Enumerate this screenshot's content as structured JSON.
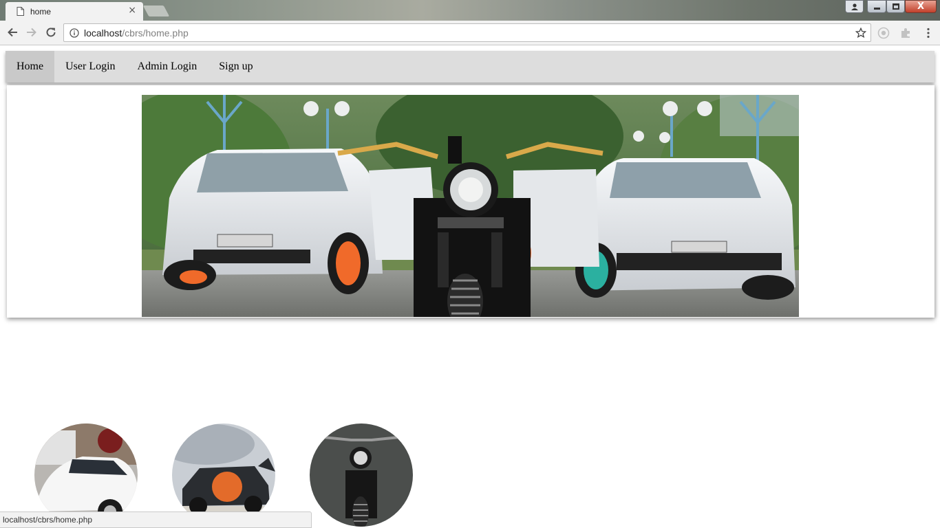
{
  "browser": {
    "tab": {
      "title": "home",
      "close_glyph": "×",
      "icon": "document-icon"
    },
    "window_controls": {
      "close_glyph": "X"
    },
    "url": {
      "host": "localhost",
      "path": "/cbrs/home.php"
    }
  },
  "nav": {
    "items": [
      {
        "label": "Home",
        "active": true
      },
      {
        "label": "User Login",
        "active": false
      },
      {
        "label": "Admin Login",
        "active": false
      },
      {
        "label": "Sign up",
        "active": false
      }
    ]
  },
  "banner": {
    "subject": "banner-image",
    "brand_colors": {
      "asphalt": "#8a8c88",
      "foliage": "#3f6b2f",
      "car_white": "#eef1f3",
      "rim_orange": "#f06a2a",
      "rim_teal": "#2bb0a0"
    }
  },
  "thumbnails": [
    {
      "subject": "white-sedan-icon"
    },
    {
      "subject": "suv-icon"
    },
    {
      "subject": "motorcycle-icon"
    }
  ],
  "status_bar": {
    "text": "localhost/cbrs/home.php"
  }
}
